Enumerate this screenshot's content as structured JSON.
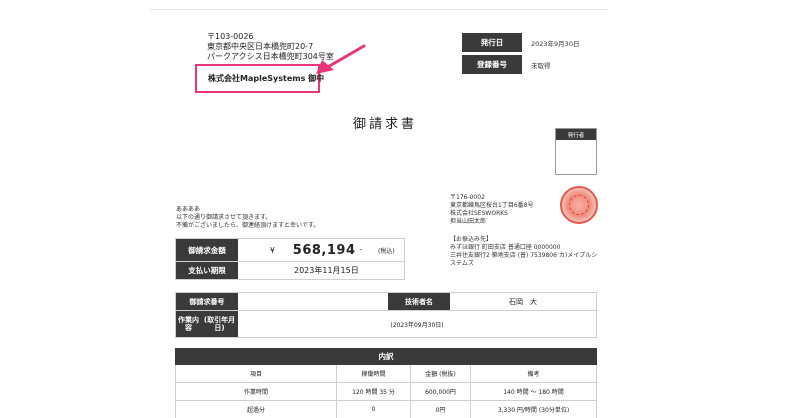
{
  "recipient": {
    "postal": "〒103-0026",
    "address1": "東京都中央区日本橋兜町20-7",
    "address2": "パークアクシス日本橋兜町304号室",
    "company": "株式会社MapleSystems 御中"
  },
  "meta": {
    "issue_date_label": "発行日",
    "issue_date": "2023年9月30日",
    "reg_no_label": "登録番号",
    "reg_no": "未取得"
  },
  "title": "御請求書",
  "issuer_label": "発行者",
  "greeting": {
    "line1": "ああああ",
    "line2": "以下の通り御請求させて頂きます。",
    "line3": "不備がございましたら、御連絡頂けますと幸いです。"
  },
  "sender": {
    "postal": "〒176-0002",
    "address": "東京都練馬区桜台1丁目6番8号",
    "company": "株式会社SESWORKS",
    "person": "担当山田太郎"
  },
  "bank": {
    "heading": "【お振込み先】",
    "line1": "みずほ銀行 町田支店 普通口座 0000000",
    "line2": "三井住友銀行2 築地支店 (普) 7539806 カ)メイプルシステムズ"
  },
  "amount": {
    "label": "御請求金額",
    "currency": "¥",
    "value": "568,194",
    "suffix": "-",
    "tax_note": "(税込)",
    "due_label": "支払い期限",
    "due_date": "2023年11月15日"
  },
  "info": {
    "invoice_no_label": "御請求番号",
    "invoice_no": "",
    "engineer_label": "技術者名",
    "engineer": "石岡　大",
    "work_label_1": "作業内容",
    "work_label_2": "(取引年月日)",
    "period": "(2023年09月30日)"
  },
  "detail": {
    "heading": "内訳",
    "columns": [
      "項目",
      "稼働時間",
      "金額 (税抜)",
      "備考"
    ],
    "rows": [
      [
        "作業時間",
        "120 時間 35 分",
        "600,000円",
        "140 時間 ～ 180 時間"
      ],
      [
        "超過分",
        "0",
        "0円",
        "3,330 円/時間 (30分単位)"
      ]
    ]
  },
  "colors": {
    "header_dark": "#3a3a3a",
    "highlight": "#e8367a",
    "seal": "#e05a4a"
  }
}
